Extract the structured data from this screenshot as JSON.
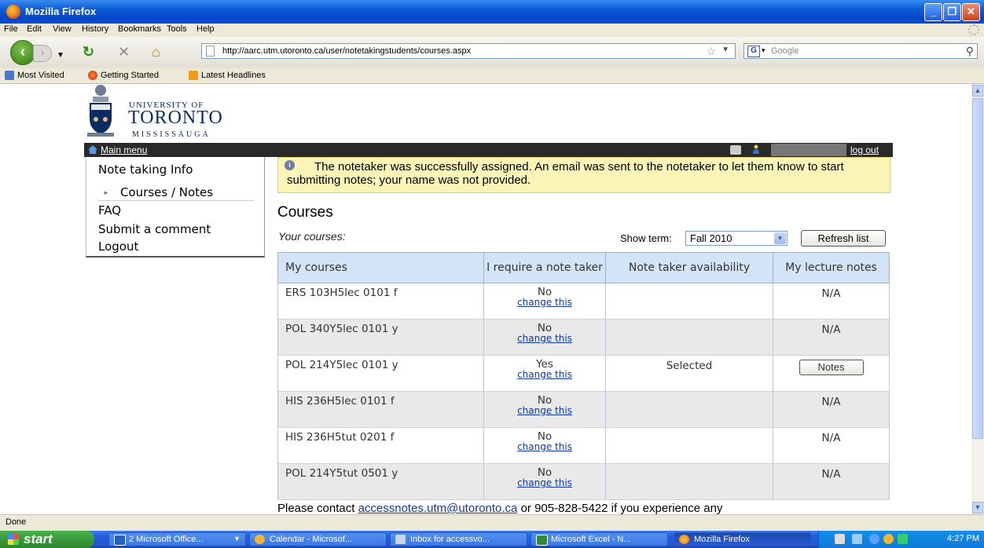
{
  "window": {
    "title": "Mozilla Firefox",
    "controls": [
      "minimize",
      "maximize",
      "close"
    ]
  },
  "menubar": [
    "File",
    "Edit",
    "View",
    "History",
    "Bookmarks",
    "Tools",
    "Help"
  ],
  "navbar": {
    "url": "http://aarc.utm.utoronto.ca/user/notetakingstudents/courses.aspx",
    "search_placeholder": "Google"
  },
  "bookmarks": [
    "Most Visited",
    "Getting Started",
    "Latest Headlines"
  ],
  "logo": {
    "line1": "UNIVERSITY OF",
    "line2": "TORONTO",
    "line3": "MISSISSAUGA"
  },
  "topbar": {
    "main_menu": "Main menu",
    "logout": "log out"
  },
  "sidebar": {
    "note_taking_info": "Note taking Info",
    "courses_notes": "Courses / Notes",
    "faq": "FAQ",
    "submit_comment": "Submit a comment",
    "logout": "Logout"
  },
  "alert": {
    "message": "The notetaker was successfully assigned. An email was sent to the notetaker to let them know to start submitting notes; your name was not provided."
  },
  "page": {
    "heading": "Courses",
    "your_courses": "Your courses:",
    "show_term_label": "Show term:",
    "term_value": "Fall 2010",
    "refresh_label": "Refresh list"
  },
  "table": {
    "headers": [
      "My courses",
      "I require a note taker",
      "Note taker availability",
      "My lecture notes"
    ],
    "rows": [
      {
        "course": "ERS 103H5lec 0101 f",
        "require": "No",
        "change": "change this",
        "availability": "",
        "notes": "N/A"
      },
      {
        "course": "POL 340Y5lec 0101 y",
        "require": "No",
        "change": "change this",
        "availability": "",
        "notes": "N/A"
      },
      {
        "course": "POL 214Y5lec 0101 y",
        "require": "Yes",
        "change": "change this",
        "availability": "Selected",
        "notes_button": "Notes"
      },
      {
        "course": "HIS 236H5lec 0101 f",
        "require": "No",
        "change": "change this",
        "availability": "",
        "notes": "N/A"
      },
      {
        "course": "HIS 236H5tut 0201 f",
        "require": "No",
        "change": "change this",
        "availability": "",
        "notes": "N/A"
      },
      {
        "course": "POL 214Y5tut 0501 y",
        "require": "No",
        "change": "change this",
        "availability": "",
        "notes": "N/A"
      }
    ]
  },
  "footer": {
    "pre": "Please contact ",
    "email": "accessnotes.utm@utoronto.ca",
    "post": " or 905-828-5422 if you experience any"
  },
  "status": {
    "text": "Done"
  },
  "taskbar": {
    "start": "start",
    "tasks": [
      "2 Microsoft Office...",
      "Calendar - Microsof...",
      "Inbox for accessvo...",
      "Microsoft Excel - N...",
      "Mozilla Firefox"
    ],
    "clock": "4:27 PM"
  },
  "colors": {
    "accent_blue": "#12389c",
    "alert_bg": "#fbf5b8",
    "table_header_bg": "#d4e4f7",
    "topbar_bg": "#2a2a2a"
  }
}
